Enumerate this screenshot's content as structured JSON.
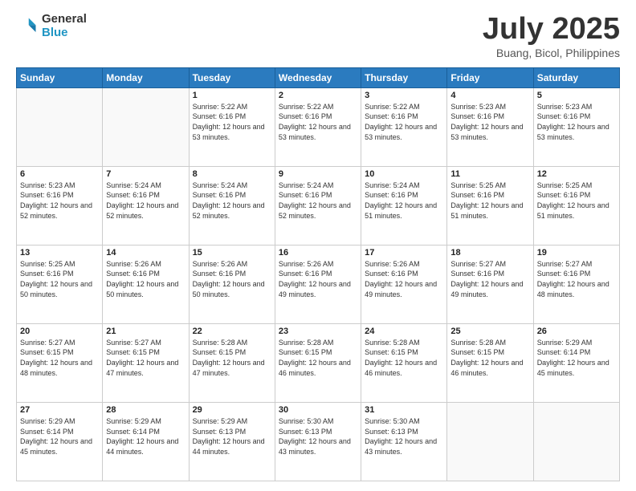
{
  "header": {
    "logo_line1": "General",
    "logo_line2": "Blue",
    "title": "July 2025",
    "subtitle": "Buang, Bicol, Philippines"
  },
  "calendar": {
    "days_of_week": [
      "Sunday",
      "Monday",
      "Tuesday",
      "Wednesday",
      "Thursday",
      "Friday",
      "Saturday"
    ],
    "weeks": [
      [
        {
          "day": null
        },
        {
          "day": null
        },
        {
          "day": "1",
          "sunrise": "Sunrise: 5:22 AM",
          "sunset": "Sunset: 6:16 PM",
          "daylight": "Daylight: 12 hours and 53 minutes."
        },
        {
          "day": "2",
          "sunrise": "Sunrise: 5:22 AM",
          "sunset": "Sunset: 6:16 PM",
          "daylight": "Daylight: 12 hours and 53 minutes."
        },
        {
          "day": "3",
          "sunrise": "Sunrise: 5:22 AM",
          "sunset": "Sunset: 6:16 PM",
          "daylight": "Daylight: 12 hours and 53 minutes."
        },
        {
          "day": "4",
          "sunrise": "Sunrise: 5:23 AM",
          "sunset": "Sunset: 6:16 PM",
          "daylight": "Daylight: 12 hours and 53 minutes."
        },
        {
          "day": "5",
          "sunrise": "Sunrise: 5:23 AM",
          "sunset": "Sunset: 6:16 PM",
          "daylight": "Daylight: 12 hours and 53 minutes."
        }
      ],
      [
        {
          "day": "6",
          "sunrise": "Sunrise: 5:23 AM",
          "sunset": "Sunset: 6:16 PM",
          "daylight": "Daylight: 12 hours and 52 minutes."
        },
        {
          "day": "7",
          "sunrise": "Sunrise: 5:24 AM",
          "sunset": "Sunset: 6:16 PM",
          "daylight": "Daylight: 12 hours and 52 minutes."
        },
        {
          "day": "8",
          "sunrise": "Sunrise: 5:24 AM",
          "sunset": "Sunset: 6:16 PM",
          "daylight": "Daylight: 12 hours and 52 minutes."
        },
        {
          "day": "9",
          "sunrise": "Sunrise: 5:24 AM",
          "sunset": "Sunset: 6:16 PM",
          "daylight": "Daylight: 12 hours and 52 minutes."
        },
        {
          "day": "10",
          "sunrise": "Sunrise: 5:24 AM",
          "sunset": "Sunset: 6:16 PM",
          "daylight": "Daylight: 12 hours and 51 minutes."
        },
        {
          "day": "11",
          "sunrise": "Sunrise: 5:25 AM",
          "sunset": "Sunset: 6:16 PM",
          "daylight": "Daylight: 12 hours and 51 minutes."
        },
        {
          "day": "12",
          "sunrise": "Sunrise: 5:25 AM",
          "sunset": "Sunset: 6:16 PM",
          "daylight": "Daylight: 12 hours and 51 minutes."
        }
      ],
      [
        {
          "day": "13",
          "sunrise": "Sunrise: 5:25 AM",
          "sunset": "Sunset: 6:16 PM",
          "daylight": "Daylight: 12 hours and 50 minutes."
        },
        {
          "day": "14",
          "sunrise": "Sunrise: 5:26 AM",
          "sunset": "Sunset: 6:16 PM",
          "daylight": "Daylight: 12 hours and 50 minutes."
        },
        {
          "day": "15",
          "sunrise": "Sunrise: 5:26 AM",
          "sunset": "Sunset: 6:16 PM",
          "daylight": "Daylight: 12 hours and 50 minutes."
        },
        {
          "day": "16",
          "sunrise": "Sunrise: 5:26 AM",
          "sunset": "Sunset: 6:16 PM",
          "daylight": "Daylight: 12 hours and 49 minutes."
        },
        {
          "day": "17",
          "sunrise": "Sunrise: 5:26 AM",
          "sunset": "Sunset: 6:16 PM",
          "daylight": "Daylight: 12 hours and 49 minutes."
        },
        {
          "day": "18",
          "sunrise": "Sunrise: 5:27 AM",
          "sunset": "Sunset: 6:16 PM",
          "daylight": "Daylight: 12 hours and 49 minutes."
        },
        {
          "day": "19",
          "sunrise": "Sunrise: 5:27 AM",
          "sunset": "Sunset: 6:16 PM",
          "daylight": "Daylight: 12 hours and 48 minutes."
        }
      ],
      [
        {
          "day": "20",
          "sunrise": "Sunrise: 5:27 AM",
          "sunset": "Sunset: 6:15 PM",
          "daylight": "Daylight: 12 hours and 48 minutes."
        },
        {
          "day": "21",
          "sunrise": "Sunrise: 5:27 AM",
          "sunset": "Sunset: 6:15 PM",
          "daylight": "Daylight: 12 hours and 47 minutes."
        },
        {
          "day": "22",
          "sunrise": "Sunrise: 5:28 AM",
          "sunset": "Sunset: 6:15 PM",
          "daylight": "Daylight: 12 hours and 47 minutes."
        },
        {
          "day": "23",
          "sunrise": "Sunrise: 5:28 AM",
          "sunset": "Sunset: 6:15 PM",
          "daylight": "Daylight: 12 hours and 46 minutes."
        },
        {
          "day": "24",
          "sunrise": "Sunrise: 5:28 AM",
          "sunset": "Sunset: 6:15 PM",
          "daylight": "Daylight: 12 hours and 46 minutes."
        },
        {
          "day": "25",
          "sunrise": "Sunrise: 5:28 AM",
          "sunset": "Sunset: 6:15 PM",
          "daylight": "Daylight: 12 hours and 46 minutes."
        },
        {
          "day": "26",
          "sunrise": "Sunrise: 5:29 AM",
          "sunset": "Sunset: 6:14 PM",
          "daylight": "Daylight: 12 hours and 45 minutes."
        }
      ],
      [
        {
          "day": "27",
          "sunrise": "Sunrise: 5:29 AM",
          "sunset": "Sunset: 6:14 PM",
          "daylight": "Daylight: 12 hours and 45 minutes."
        },
        {
          "day": "28",
          "sunrise": "Sunrise: 5:29 AM",
          "sunset": "Sunset: 6:14 PM",
          "daylight": "Daylight: 12 hours and 44 minutes."
        },
        {
          "day": "29",
          "sunrise": "Sunrise: 5:29 AM",
          "sunset": "Sunset: 6:13 PM",
          "daylight": "Daylight: 12 hours and 44 minutes."
        },
        {
          "day": "30",
          "sunrise": "Sunrise: 5:30 AM",
          "sunset": "Sunset: 6:13 PM",
          "daylight": "Daylight: 12 hours and 43 minutes."
        },
        {
          "day": "31",
          "sunrise": "Sunrise: 5:30 AM",
          "sunset": "Sunset: 6:13 PM",
          "daylight": "Daylight: 12 hours and 43 minutes."
        },
        {
          "day": null
        },
        {
          "day": null
        }
      ]
    ]
  }
}
